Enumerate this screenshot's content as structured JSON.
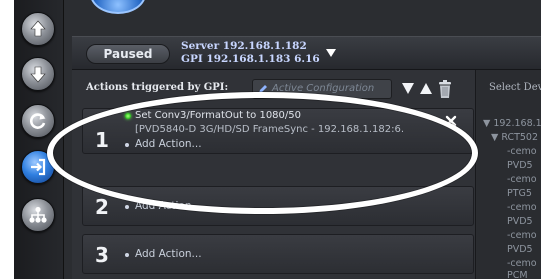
{
  "status": {
    "state_label": "Paused",
    "server_line": "Server 192.168.1.182",
    "gpi_line": "GPI 192.168.1.183 6.16"
  },
  "actions": {
    "header_label": "Actions triggered by GPI:",
    "config_placeholder": "Active Configuration",
    "rows": [
      {
        "number": "1",
        "active": true,
        "lines": [
          "Set Conv3/FormatOut to 1080/50",
          "[PVD5840-D 3G/HD/SD FrameSync - 192.168.1.182:6."
        ],
        "add_label": "Add Action..."
      },
      {
        "number": "2",
        "add_label": "Add Action..."
      },
      {
        "number": "3",
        "add_label": "Add Action..."
      }
    ]
  },
  "device_panel": {
    "label": "Select Dev",
    "tree": [
      "▼ 192.168.1",
      "▼ RCT502",
      "-cemo",
      "PVD5",
      "-cemo",
      "PTG5",
      "-cemo",
      "PVD5",
      "-cemo",
      "PVD5",
      "-cemo",
      "PCM"
    ]
  },
  "colors": {
    "status_green": "#27c41b",
    "rail_active": "#2f7fe0",
    "annotation": "#ffffff"
  },
  "icons": [
    "arrow-up-icon",
    "arrow-down-icon",
    "refresh-icon",
    "login-icon",
    "network-icon",
    "pencil-icon",
    "triangle-down-icon",
    "triangle-up-icon",
    "trash-icon",
    "close-icon"
  ]
}
